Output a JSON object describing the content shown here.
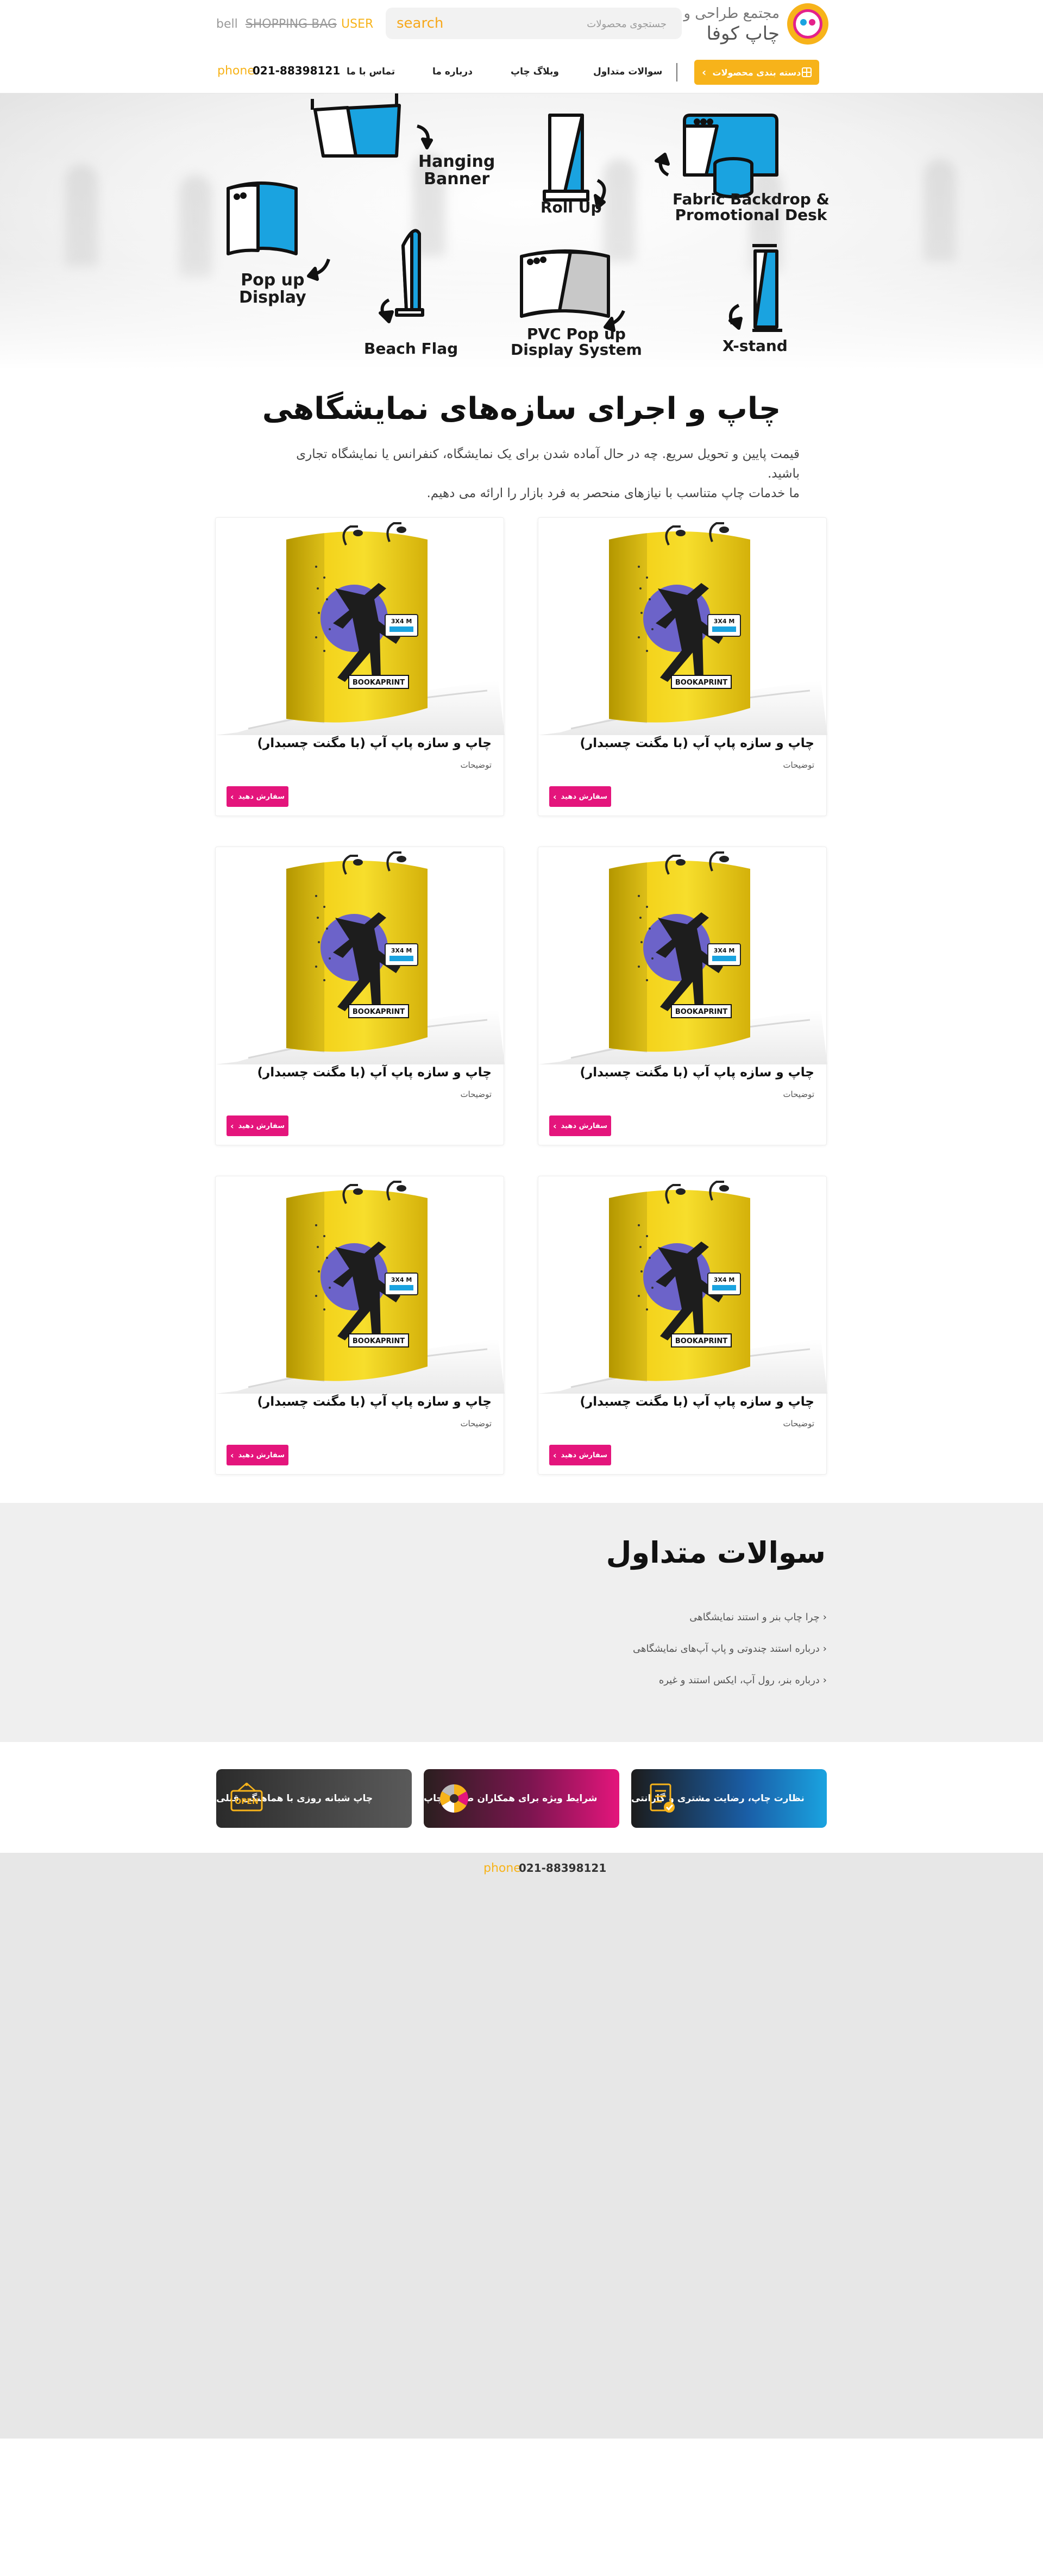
{
  "header": {
    "logo_line1": "مجتمع طراحی و",
    "logo_line2": "چاپ کوفا",
    "search_label": "search",
    "search_placeholder": "جستجوی محصولات",
    "icon_bell": "bell",
    "icon_bag": "SHOPPING-BAG",
    "icon_user": "USER"
  },
  "nav": {
    "category_button": "دسته بندی محصولات",
    "items": [
      "سوالات متداول",
      "وبلاگ چاپ",
      "درباره ما",
      "تماس با ما"
    ],
    "phone_icon": "phone",
    "phone": "021-88398121"
  },
  "hero": {
    "labels": {
      "hanging_banner": "Hanging\nBanner",
      "roll_up": "Roll Up",
      "fabric_backdrop": "Fabric Backdrop &\nPromotional Desk",
      "pop_up": "Pop up\nDisplay",
      "beach_flag": "Beach Flag",
      "pvc": "PVC Pop up\nDisplay System",
      "x_stand": "X-stand"
    }
  },
  "intro": {
    "title": "چاپ و اجرای سازه‌های نمایشگاهی",
    "line1": "قیمت پایین و تحویل سریع. چه در حال آماده شدن برای یک نمایشگاه، کنفرانس یا نمایشگاه تجاری باشید.",
    "line2": "ما خدمات چاپ متناسب با نیازهای منحصر به فرد بازار را ارائه می دهیم."
  },
  "products": [
    {
      "title": "چاپ و سازه پاپ آپ (با مگنت چسبدار)",
      "desc": "توضیحات",
      "button": "سفارش دهید",
      "poster_text": "BOOKAPRINT",
      "badge_text": "3X4 M"
    },
    {
      "title": "چاپ و سازه پاپ آپ (با مگنت چسبدار)",
      "desc": "توضیحات",
      "button": "سفارش دهید",
      "poster_text": "BOOKAPRINT",
      "badge_text": "3X4 M"
    },
    {
      "title": "چاپ و سازه پاپ آپ (با مگنت چسبدار)",
      "desc": "توضیحات",
      "button": "سفارش دهید",
      "poster_text": "BOOKAPRINT",
      "badge_text": "3X4 M"
    },
    {
      "title": "چاپ و سازه پاپ آپ (با مگنت چسبدار)",
      "desc": "توضیحات",
      "button": "سفارش دهید",
      "poster_text": "BOOKAPRINT",
      "badge_text": "3X4 M"
    },
    {
      "title": "چاپ و سازه پاپ آپ (با مگنت چسبدار)",
      "desc": "توضیحات",
      "button": "سفارش دهید",
      "poster_text": "BOOKAPRINT",
      "badge_text": "3X4 M"
    },
    {
      "title": "چاپ و سازه پاپ آپ (با مگنت چسبدار)",
      "desc": "توضیحات",
      "button": "سفارش دهید",
      "poster_text": "BOOKAPRINT",
      "badge_text": "3X4 M"
    }
  ],
  "faq": {
    "title": "سوالات متداول",
    "items": [
      "چرا چاپ بنر و استند نمایشگاهی",
      "درباره استند چندوتی و پاپ آپ‌های نمایشگاهی",
      "درباره بنر، رول آپ، ایکس استند و غیره"
    ]
  },
  "features": [
    {
      "label": "نظارت چاپ، رضایت مشتری و گارانتی",
      "icon": "document-check-icon"
    },
    {
      "label": "شرایط ویژه برای همکاران صنعت چاپ",
      "icon": "color-wheel-icon"
    },
    {
      "label": "چاپ شبانه روزی با هماهنگی قبلی",
      "icon": "open-sign-icon",
      "icon_text": "OPEN"
    }
  ],
  "footer": {
    "phone_icon": "phone",
    "phone": "021-88398121"
  },
  "colors": {
    "brand_yellow": "#f7b31a",
    "brand_pink": "#e4157c",
    "brand_blue": "#1aa3e0",
    "faq_bg": "#efefef",
    "footer_bg": "#e7e7e7"
  }
}
